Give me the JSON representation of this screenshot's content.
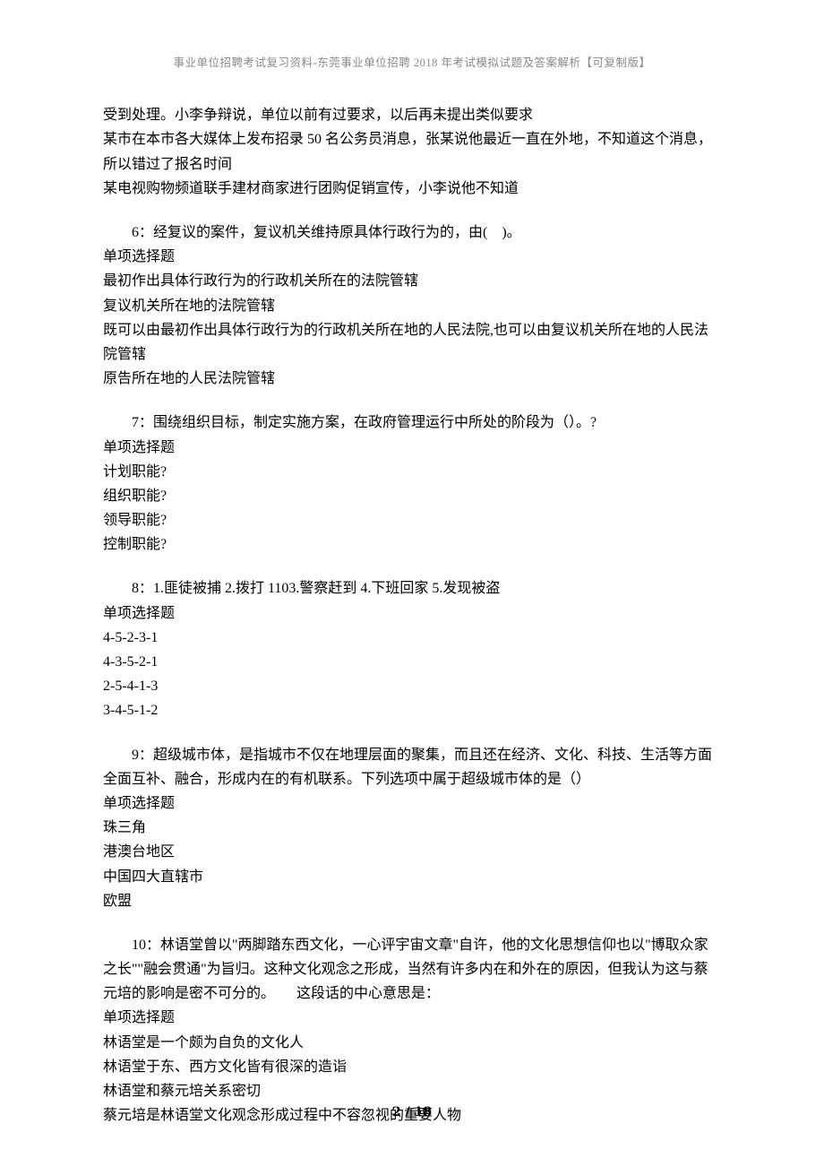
{
  "header": "事业单位招聘考试复习资料-东莞事业单位招聘 2018 年考试模拟试题及答案解析【可复制版】",
  "prelude": {
    "p1": "受到处理。小李争辩说，单位以前有过要求，以后再未提出类似要求",
    "p2": "某市在本市各大媒体上发布招录 50 名公务员消息，张某说他最近一直在外地，不知道这个消息，所以错过了报名时间",
    "p3": "某电视购物频道联手建材商家进行团购促销宣传，小李说他不知道"
  },
  "q6": {
    "stem": "6：经复议的案件，复议机关维持原具体行政行为的，由(　)。",
    "type": "单项选择题",
    "a": "最初作出具体行政行为的行政机关所在的法院管辖",
    "b": "复议机关所在地的法院管辖",
    "c": "既可以由最初作出具体行政行为的行政机关所在地的人民法院,也可以由复议机关所在地的人民法院管辖",
    "d": "原告所在地的人民法院管辖"
  },
  "q7": {
    "stem": "7：围绕组织目标，制定实施方案，在政府管理运行中所处的阶段为（）。?",
    "type": "单项选择题",
    "a": "计划职能?",
    "b": "组织职能?",
    "c": "领导职能?",
    "d": "控制职能?"
  },
  "q8": {
    "stem": "8：1.匪徒被捕 2.拨打 1103.警察赶到 4.下班回家 5.发现被盗",
    "type": "单项选择题",
    "a": "4-5-2-3-1",
    "b": "4-3-5-2-1",
    "c": "2-5-4-1-3",
    "d": "3-4-5-1-2"
  },
  "q9": {
    "stem": "9：超级城市体，是指城市不仅在地理层面的聚集，而且还在经济、文化、科技、生活等方面全面互补、融合，形成内在的有机联系。下列选项中属于超级城市体的是（）",
    "type": "单项选择题",
    "a": "珠三角",
    "b": "港澳台地区",
    "c": "中国四大直辖市",
    "d": "欧盟"
  },
  "q10": {
    "stem": "10：林语堂曾以\"两脚踏东西文化，一心评宇宙文章\"自许，他的文化思想信仰也以\"博取众家之长\"\"融会贯通\"为旨归。这种文化观念之形成，当然有许多内在和外在的原因，但我认为这与蔡元培的影响是密不可分的。　　这段话的中心意思是：",
    "type": "单项选择题",
    "a": "林语堂是一个颇为自负的文化人",
    "b": "林语堂于东、西方文化皆有很深的造诣",
    "c": "林语堂和蔡元培关系密切",
    "d": "蔡元培是林语堂文化观念形成过程中不容忽视的重要人物"
  },
  "footer": "2 / 18"
}
